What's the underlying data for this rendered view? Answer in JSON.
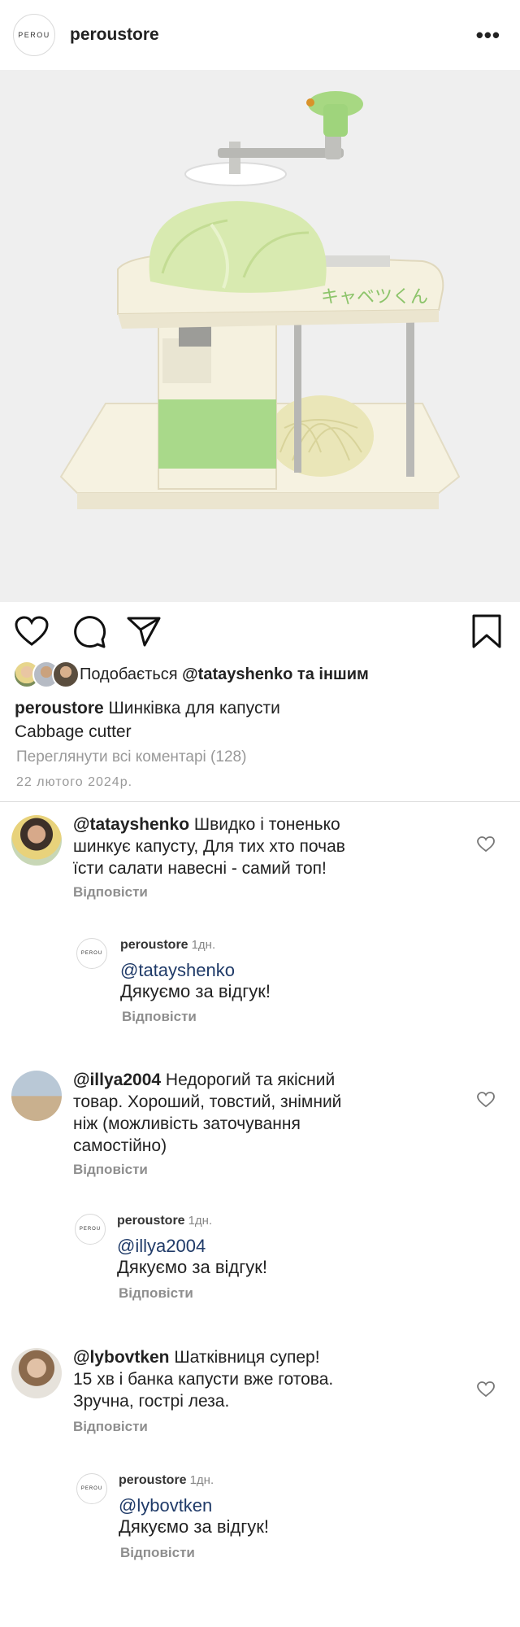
{
  "header": {
    "logo_text": "PEROU",
    "username": "peroustore",
    "more_icon": "more-horizontal-icon"
  },
  "post": {
    "image_alt": "cabbage-slicer-photo",
    "product_label": "キャベツくん"
  },
  "actions": {
    "like_icon": "heart-icon",
    "comment_icon": "comment-icon",
    "share_icon": "send-icon",
    "save_icon": "bookmark-icon"
  },
  "likes": {
    "prefix": "Подобається ",
    "user": "@tatayshenko",
    "suffix": " та іншим"
  },
  "caption": {
    "username": "peroustore",
    "line1": " Шинківка для капусти",
    "line2": "Cabbage cutter"
  },
  "view_all_comments": "Переглянути всі коментарі (128)",
  "date": "22 лютого 2024р.",
  "comments": [
    {
      "username": "@tatayshenko",
      "lines": [
        " Швидко і тоненько",
        "шинкує капусту, Для тих хто почав",
        "їсти салати навесні - самий топ!"
      ],
      "reply_label": "Відповісти",
      "reply": {
        "avatar_text": "PEROU",
        "username": "peroustore",
        "time": "1дн.",
        "mention": "@tatayshenko",
        "text": "Дякуємо за відгук!",
        "reply_label": "Відповісти"
      }
    },
    {
      "username": "@illya2004",
      "lines": [
        " Недорогий та якісний",
        "товар. Хороший, товстий, знімний",
        "ніж (можливість заточування",
        "самостійно)"
      ],
      "reply_label": "Відповісти",
      "reply": {
        "avatar_text": "PEROU",
        "username": "peroustore",
        "time": "1дн.",
        "mention": "@illya2004",
        "text": "Дякуємо за відгук!",
        "reply_label": "Відповісти"
      }
    },
    {
      "username": "@lybovtken",
      "lines": [
        " Шатківниця супер!",
        "15 хв і банка капусти вже готова.",
        "Зручна, гострі леза."
      ],
      "reply_label": "Відповісти",
      "reply": {
        "avatar_text": "PEROU",
        "username": "peroustore",
        "time": "1дн.",
        "mention": "@lybovtken",
        "text": "Дякуємо за відгук!",
        "reply_label": "Відповісти"
      }
    }
  ],
  "colors": {
    "accent_green": "#a9d98a",
    "cream": "#f4f0de",
    "mention_blue": "#1f3a68",
    "muted": "#8e8e8e"
  }
}
